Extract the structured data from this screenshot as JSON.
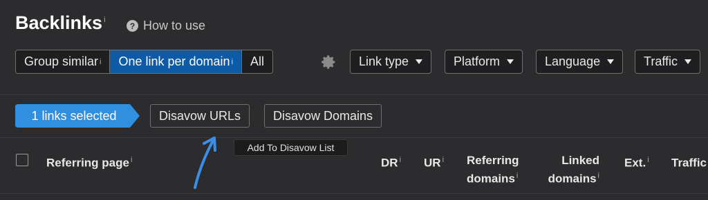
{
  "header": {
    "title": "Backlinks",
    "title_info": "i",
    "help_icon": "question-circle-icon",
    "help_label": "How to use"
  },
  "mode_toggle": {
    "options": [
      {
        "label": "Group similar",
        "info": "i",
        "active": false
      },
      {
        "label": "One link per domain",
        "info": "i",
        "active": true
      },
      {
        "label": "All",
        "info": "",
        "active": false
      }
    ],
    "active_color": "#0d5aa7"
  },
  "settings_icon": "gear-icon",
  "filters": [
    {
      "label": "Link type"
    },
    {
      "label": "Platform"
    },
    {
      "label": "Language"
    },
    {
      "label": "Traffic"
    }
  ],
  "selection_bar": {
    "selected_label": "1 links selected",
    "selected_color": "#2f8fe0",
    "disavow_urls": "Disavow URLs",
    "disavow_domains": "Disavow Domains"
  },
  "tooltip": {
    "text": "Add To Disavow List"
  },
  "table": {
    "columns": [
      {
        "line1": "Referring page",
        "line2": "",
        "info": "i"
      },
      {
        "line1": "DR",
        "line2": "",
        "info": "i"
      },
      {
        "line1": "UR",
        "line2": "",
        "info": "i"
      },
      {
        "line1": "Referring",
        "line2": "domains",
        "info": "i"
      },
      {
        "line1": "Linked",
        "line2": "domains",
        "info": "i"
      },
      {
        "line1": "Ext.",
        "line2": "",
        "info": "i"
      },
      {
        "line1": "Traffic",
        "line2": "",
        "info": "i"
      }
    ]
  },
  "annotation": {
    "arrow_color": "#3a8ee6"
  }
}
